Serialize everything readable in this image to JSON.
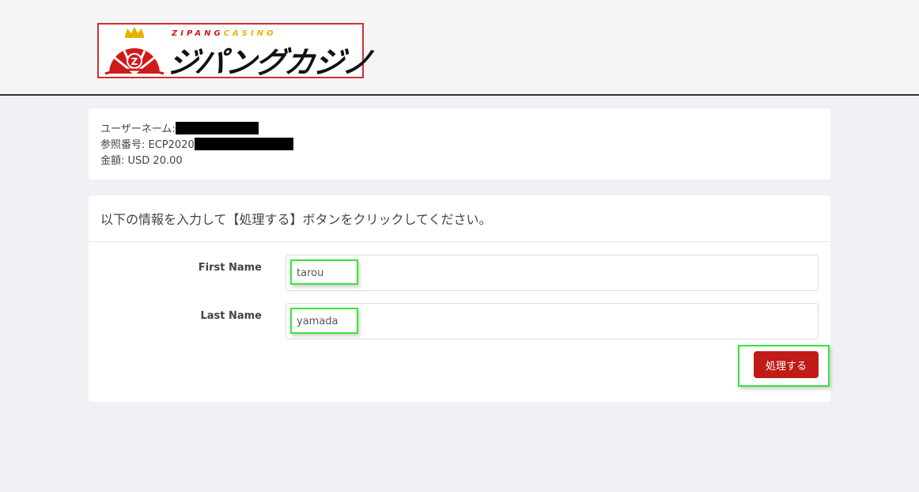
{
  "header": {
    "logo": {
      "sub_left": "ZIPANG",
      "sub_right": "CASINO",
      "main": "ジパングカジノ",
      "emblem_letter": "Z",
      "colors": {
        "red": "#d01a1a",
        "gold": "#e6b400",
        "border": "#d32f2f"
      }
    }
  },
  "info": {
    "username_label": "ユーザーネーム:",
    "reference_label": "参照番号: ECP2020",
    "amount_label": "金額: USD 20.00"
  },
  "form": {
    "instruction": "以下の情報を入力して【処理する】ボタンをクリックしてください。",
    "first_name": {
      "label": "First Name",
      "value": "tarou"
    },
    "last_name": {
      "label": "Last Name",
      "value": "yamada"
    },
    "submit_label": "処理する"
  },
  "colors": {
    "background": "#f0f1f5",
    "button": "#c11b17",
    "highlight": "#39e339"
  }
}
